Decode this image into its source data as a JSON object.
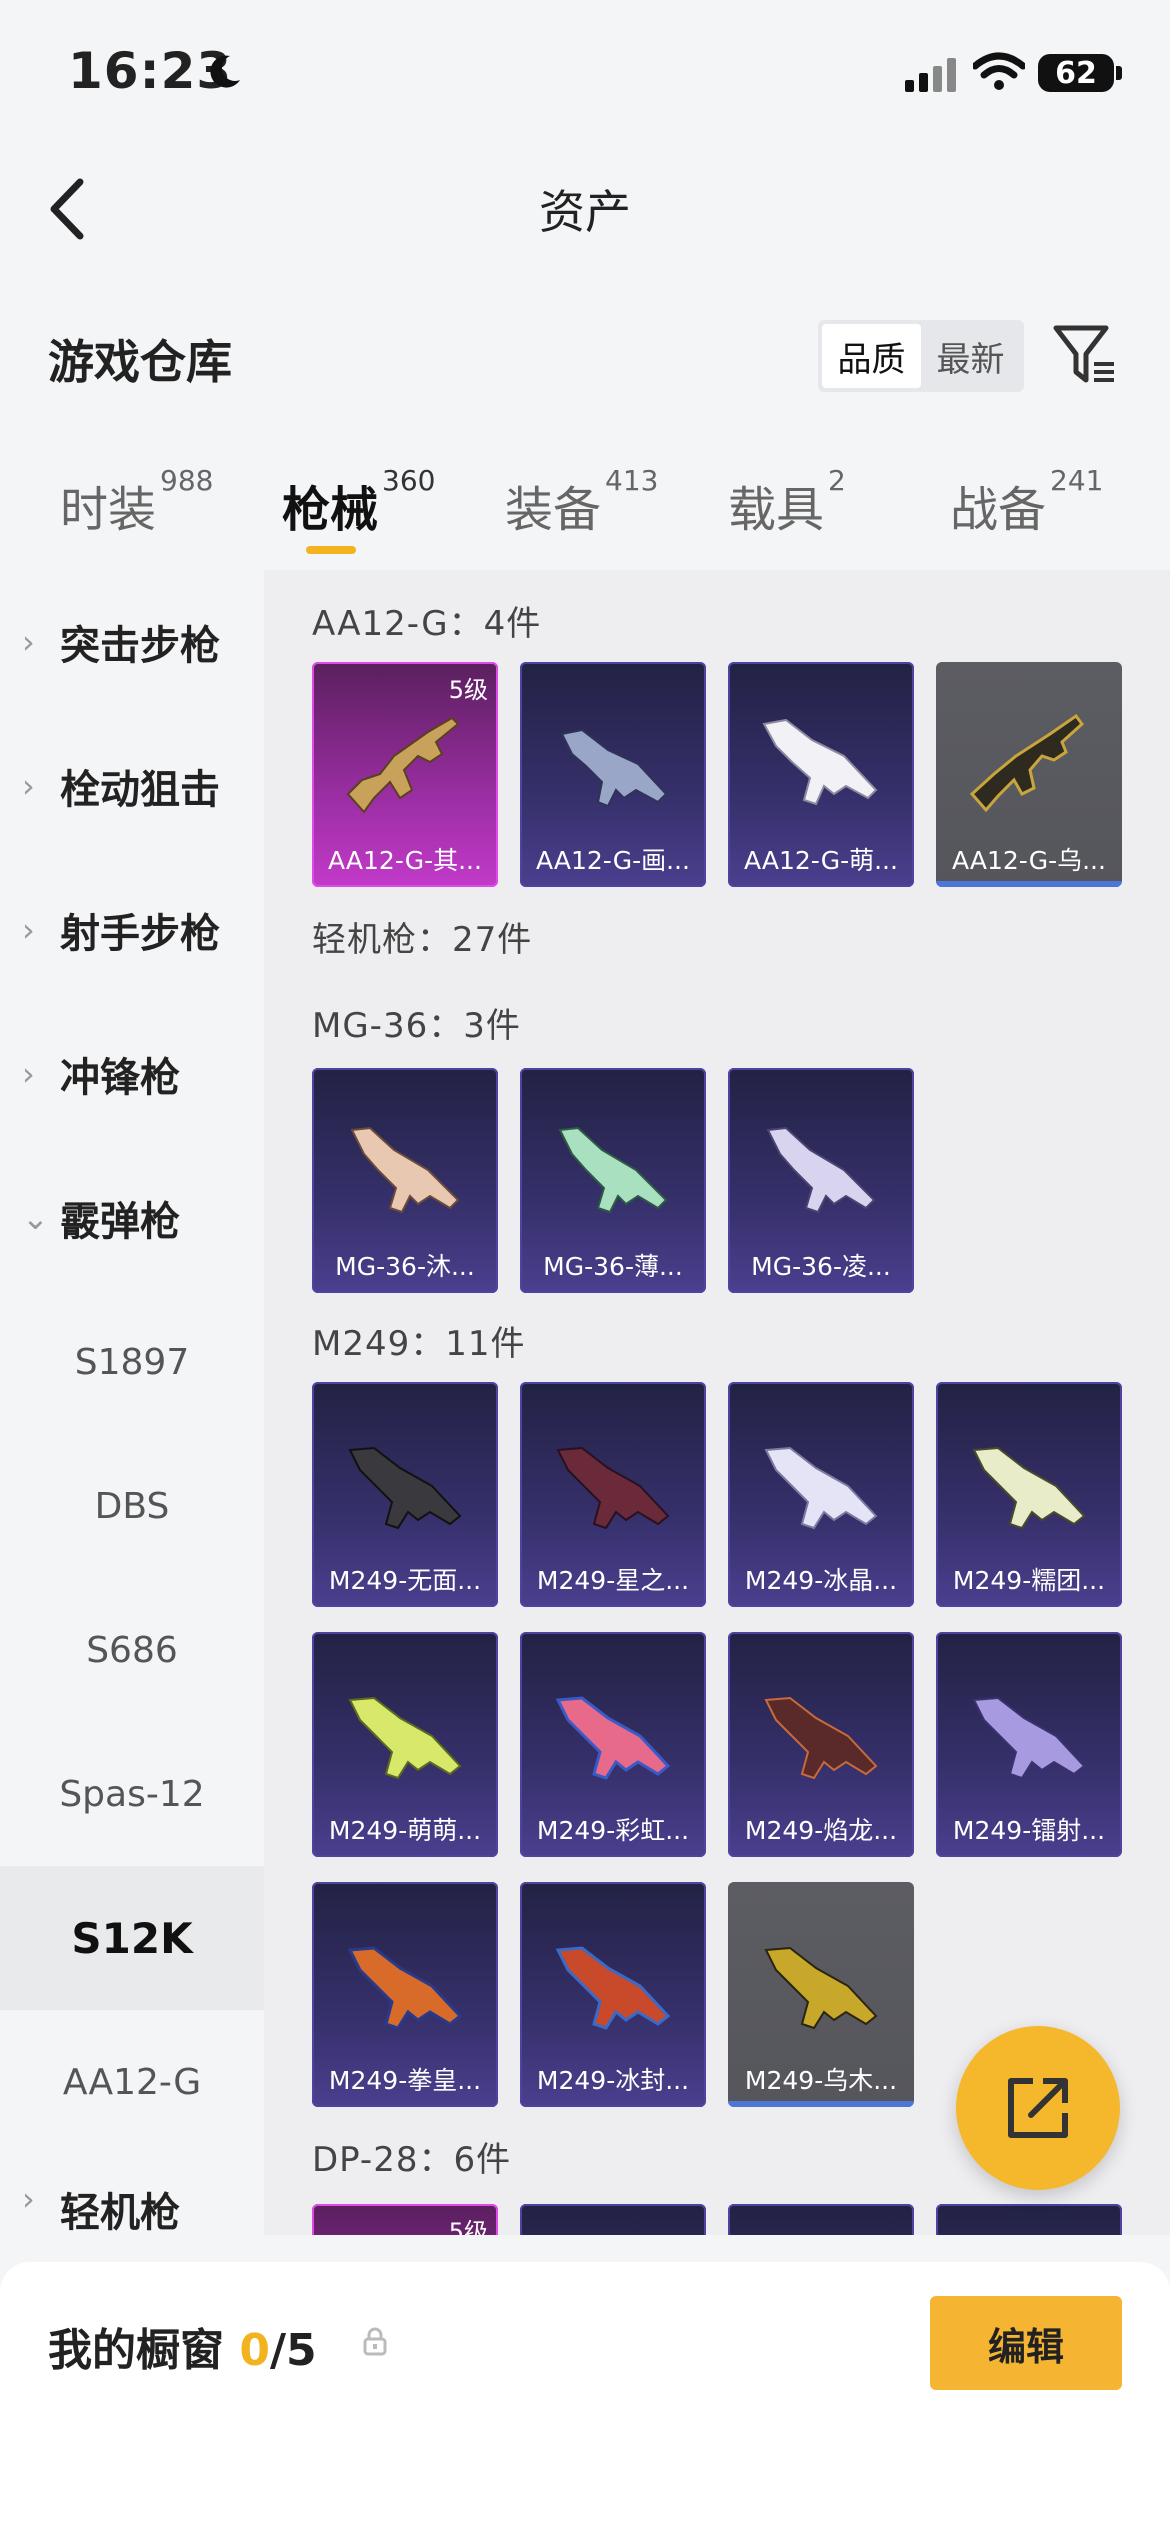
{
  "status_bar": {
    "time": "16:23",
    "battery": "62"
  },
  "header": {
    "title": "资产"
  },
  "section": {
    "title": "游戏仓库"
  },
  "sort": {
    "quality": "品质",
    "latest": "最新"
  },
  "tabs": [
    {
      "label": "时装",
      "count": "988"
    },
    {
      "label": "枪械",
      "count": "360"
    },
    {
      "label": "装备",
      "count": "413"
    },
    {
      "label": "载具",
      "count": "2"
    },
    {
      "label": "战备",
      "count": "241"
    }
  ],
  "sidebar": {
    "categories": [
      "突击步枪",
      "栓动狙击",
      "射手步枪",
      "冲锋枪",
      "霰弹枪"
    ],
    "shotguns": [
      "S1897",
      "DBS",
      "S686",
      "Spas-12",
      "S12K",
      "AA12-G"
    ],
    "last_category": "轻机枪"
  },
  "groups": {
    "aa12": "AA12-G：4件",
    "lmg": "轻机枪：27件",
    "mg36": "MG-36：3件",
    "m249": "M249：11件",
    "dp28": "DP-28：6件"
  },
  "cards": {
    "aa12": [
      {
        "name": "AA12-G-其...",
        "level": "5级",
        "rarity": "pink"
      },
      {
        "name": "AA12-G-画...",
        "rarity": "purple"
      },
      {
        "name": "AA12-G-萌...",
        "rarity": "purple"
      },
      {
        "name": "AA12-G-乌...",
        "rarity": "grey"
      }
    ],
    "mg36": [
      {
        "name": "MG-36-沐...",
        "rarity": "purple"
      },
      {
        "name": "MG-36-薄...",
        "rarity": "purple"
      },
      {
        "name": "MG-36-凌...",
        "rarity": "purple"
      }
    ],
    "m249": [
      {
        "name": "M249-无面...",
        "rarity": "purple"
      },
      {
        "name": "M249-星之...",
        "rarity": "purple"
      },
      {
        "name": "M249-冰晶...",
        "rarity": "purple"
      },
      {
        "name": "M249-糯团...",
        "rarity": "purple"
      },
      {
        "name": "M249-萌萌...",
        "rarity": "purple"
      },
      {
        "name": "M249-彩虹...",
        "rarity": "purple"
      },
      {
        "name": "M249-焰龙...",
        "rarity": "purple"
      },
      {
        "name": "M249-镭射...",
        "rarity": "purple"
      },
      {
        "name": "M249-拳皇...",
        "rarity": "purple"
      },
      {
        "name": "M249-冰封...",
        "rarity": "purple"
      },
      {
        "name": "M249-乌木...",
        "rarity": "grey"
      }
    ],
    "dp28_level": "5级"
  },
  "bottom": {
    "label": "我的橱窗",
    "current": "0",
    "total": "/5",
    "edit": "编辑"
  },
  "colors": {
    "accent": "#f2b31f",
    "epic": "#c23ac9",
    "rare": "#4b3f8f",
    "common": "#55565c"
  }
}
